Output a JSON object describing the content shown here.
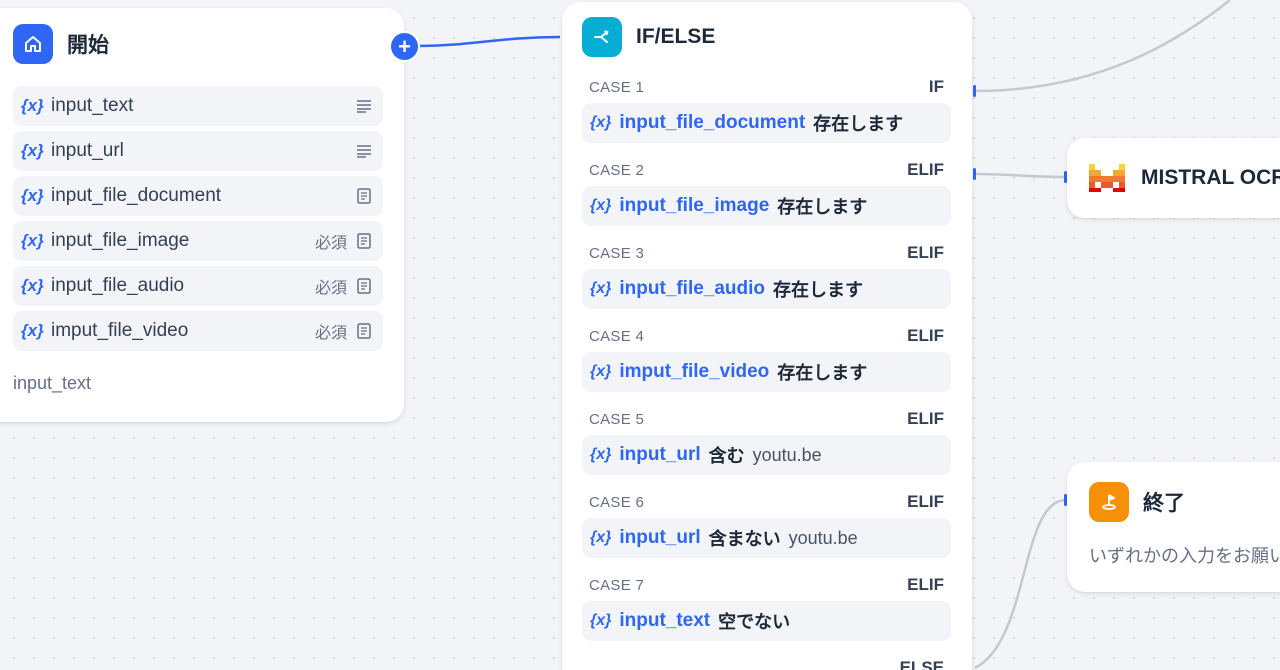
{
  "start": {
    "title": "開始",
    "variables": [
      {
        "name": "input_text",
        "required": "",
        "type": "paragraph"
      },
      {
        "name": "input_url",
        "required": "",
        "type": "paragraph"
      },
      {
        "name": "input_file_document",
        "required": "",
        "type": "file"
      },
      {
        "name": "input_file_image",
        "required": "必須",
        "type": "file"
      },
      {
        "name": "input_file_audio",
        "required": "必須",
        "type": "file"
      },
      {
        "name": "imput_file_video",
        "required": "必須",
        "type": "file"
      }
    ],
    "footer": "input_text",
    "add_symbol": "+"
  },
  "ifelse": {
    "title": "IF/ELSE",
    "cases": [
      {
        "label": "CASE 1",
        "keyword": "IF",
        "var": "input_file_document",
        "op": "存在します",
        "value": ""
      },
      {
        "label": "CASE 2",
        "keyword": "ELIF",
        "var": "input_file_image",
        "op": "存在します",
        "value": ""
      },
      {
        "label": "CASE 3",
        "keyword": "ELIF",
        "var": "input_file_audio",
        "op": "存在します",
        "value": ""
      },
      {
        "label": "CASE 4",
        "keyword": "ELIF",
        "var": "imput_file_video",
        "op": "存在します",
        "value": ""
      },
      {
        "label": "CASE 5",
        "keyword": "ELIF",
        "var": "input_url",
        "op": "含む",
        "value": "youtu.be"
      },
      {
        "label": "CASE 6",
        "keyword": "ELIF",
        "var": "input_url",
        "op": "含まない",
        "value": "youtu.be"
      },
      {
        "label": "CASE 7",
        "keyword": "ELIF",
        "var": "input_text",
        "op": "空でない",
        "value": ""
      }
    ],
    "else_keyword": "ELSE",
    "var_symbol": "{x}"
  },
  "mistral": {
    "title": "MISTRAL OCR"
  },
  "end": {
    "title": "終了",
    "description": "いずれかの入力をお願いします"
  },
  "colors": {
    "accent": "#2e67f5",
    "start_icon": "#2e67f5",
    "ifelse_icon": "#06aed4",
    "end_icon": "#f79009",
    "mistral_red": "#e10500",
    "mistral_orange": "#fa8f00"
  },
  "icons": {
    "start": "home-icon",
    "ifelse": "branch-icon",
    "end": "flag-icon",
    "mistral": "mistral-logo",
    "paragraph": "paragraph-icon",
    "file": "document-icon"
  }
}
